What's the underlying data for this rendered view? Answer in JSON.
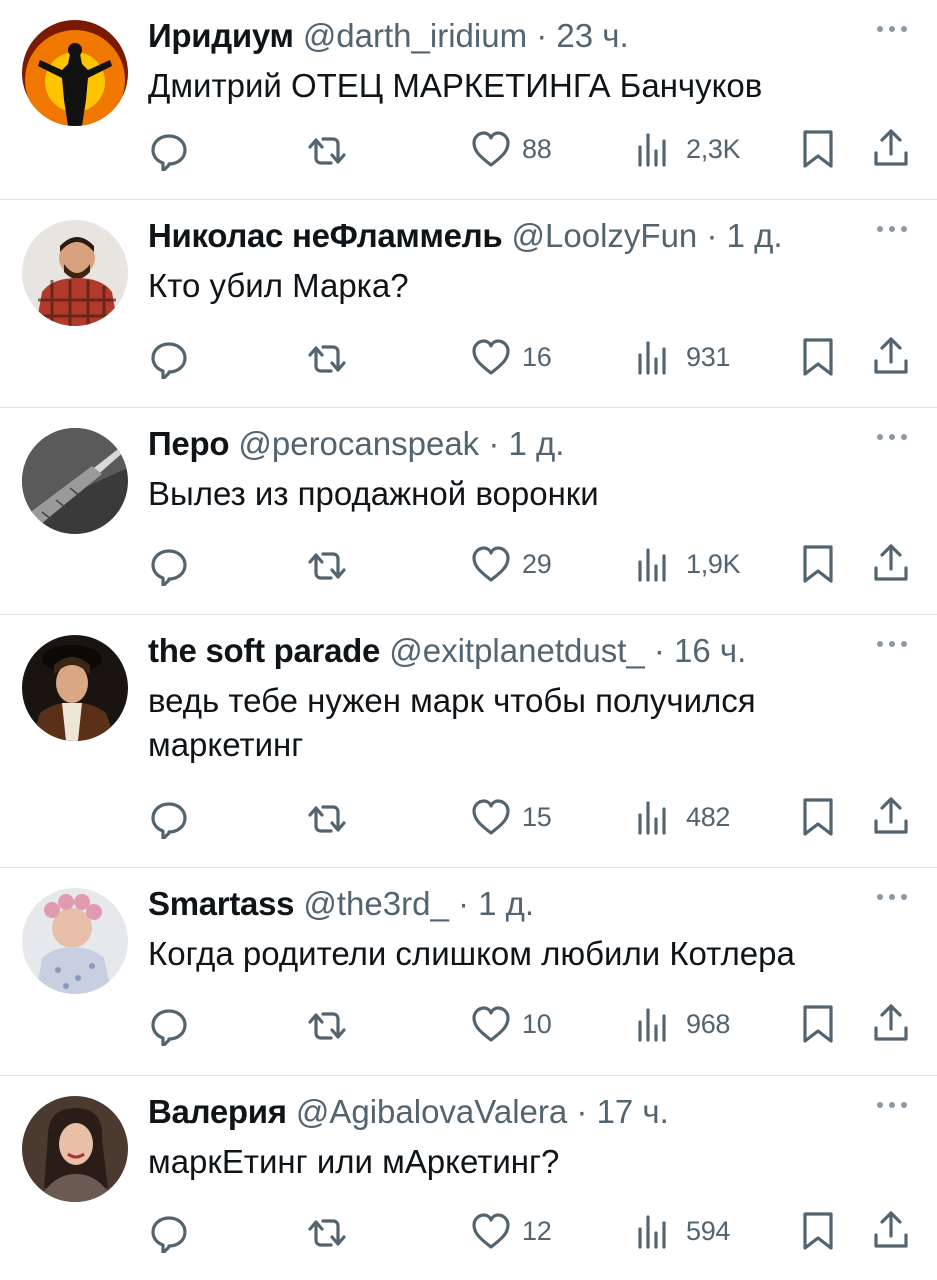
{
  "tweets": [
    {
      "name": "Иридиум",
      "handle": "@darth_iridium",
      "time": "23 ч.",
      "text": "Дмитрий ОТЕЦ МАРКЕТИНГА Банчуков",
      "likes": "88",
      "views": "2,3K",
      "avatar": "fire-figure",
      "avatar_colors": [
        "#7a1a00",
        "#f07800",
        "#ffc400"
      ]
    },
    {
      "name": "Николас неФламмель",
      "handle": "@LoolzyFun",
      "time": "1 д.",
      "text": "Кто убил Марка?",
      "likes": "16",
      "views": "931",
      "avatar": "person-plaid",
      "avatar_colors": [
        "#e8e5e0",
        "#b23a2a",
        "#5a3a28"
      ]
    },
    {
      "name": "Перо",
      "handle": "@perocanspeak",
      "time": "1 д.",
      "text": "Вылез из продажной воронки",
      "likes": "29",
      "views": "1,9K",
      "avatar": "feather-metal",
      "avatar_colors": [
        "#3a3a3a",
        "#9a9a9a",
        "#d8d8d8"
      ]
    },
    {
      "name": "the soft parade",
      "handle": "@exitplanetdust_",
      "time": "16 ч.",
      "text": "ведь тебе нужен марк чтобы получился маркетинг",
      "likes": "15",
      "views": "482",
      "avatar": "renaissance-portrait",
      "avatar_colors": [
        "#1a1410",
        "#d9a882",
        "#5a3018"
      ]
    },
    {
      "name": "Smartass",
      "handle": "@the3rd_",
      "time": "1 д.",
      "text": "Когда родители слишком любили Котлера",
      "likes": "10",
      "views": "968",
      "avatar": "woman-curlers",
      "avatar_colors": [
        "#c7cfe0",
        "#e09cae",
        "#8a9bbf"
      ]
    },
    {
      "name": "Валерия",
      "handle": "@AgibalovaValera",
      "time": "17 ч.",
      "text": "маркЕтинг или мАркетинг?",
      "likes": "12",
      "views": "594",
      "avatar": "woman-portrait",
      "avatar_colors": [
        "#4a3a30",
        "#e8c0a8",
        "#2a1c16"
      ]
    }
  ],
  "colors": {
    "text": "#0f1419",
    "muted": "#536471",
    "divider": "#e1e6ea"
  },
  "icons": [
    "reply-icon",
    "retweet-icon",
    "like-icon",
    "views-icon",
    "bookmark-icon",
    "share-icon",
    "more-icon"
  ]
}
